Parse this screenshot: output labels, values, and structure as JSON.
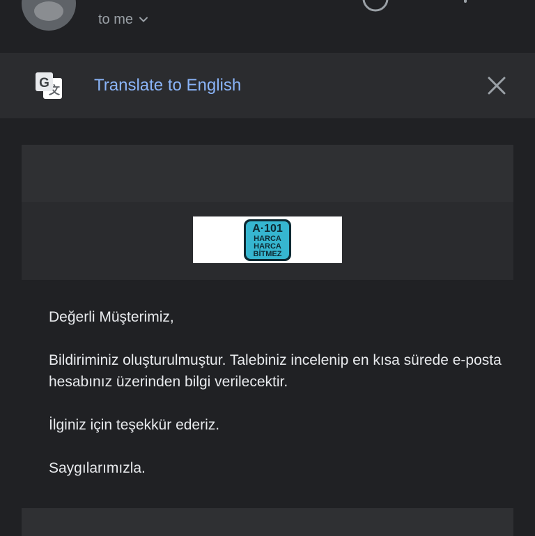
{
  "header": {
    "recipient_label": "to me",
    "chevron_icon": "chevron-down-icon",
    "avatar_icon": "person-avatar-icon"
  },
  "translate_bar": {
    "icon": "google-translate-icon",
    "link_label": "Translate to English",
    "close_icon": "close-icon",
    "link_color": "#8ab4f8"
  },
  "email": {
    "logo": {
      "brand_icon": "a101-logo",
      "lines": [
        "A·101",
        "HARCA",
        "HARCA",
        "BİTMEZ"
      ],
      "color": "#36b6d0"
    },
    "paragraphs": [
      "Değerli Müşterimiz,",
      "Bildiriminiz oluşturulmuştur. Talebiniz incelenip en kısa sürede e-posta hesabınız üzerinden bilgi verilecektir.",
      "İlginiz için teşekkür ederiz.",
      "Saygılarımızla."
    ]
  }
}
